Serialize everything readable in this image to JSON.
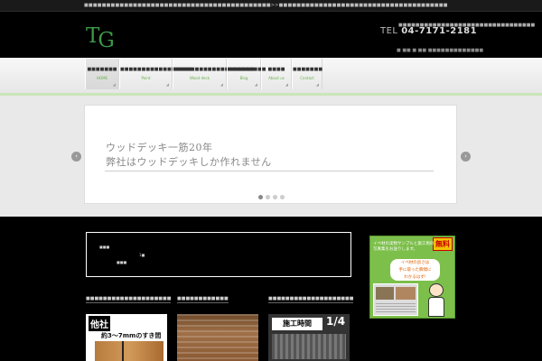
{
  "topbar": {
    "description": "■■■■■■■■■■■■■■■■■■■■■■■■■■■■■■■■■■■■■■■■■■>>■■■■■■■■■■■■■■■■■■■■■■■■■■■■■■■■■■■■■■"
  },
  "header": {
    "logo_t": "T",
    "logo_g": "G",
    "contact_top": "■■■■■■■■■■■■■■■■■■■■■■■■■■■■■■■■",
    "tel_label": "TEL",
    "tel_number": "04-7171-2181",
    "contact_bottom": "■ ■■  ■ ■■ ■■■■■■■■■■■■■"
  },
  "nav": {
    "items": [
      {
        "jp": "■■■■■■■",
        "en": "HOME"
      },
      {
        "jp": "■■■■■■■■■■■■■■■■■",
        "en": "Point"
      },
      {
        "jp": "■■■■■■■■■■■■■■■■■■■",
        "en": "Wood deck"
      },
      {
        "jp": "■■■■■■■■■",
        "en": "Blog"
      },
      {
        "jp": "■■■■",
        "en": "About us"
      },
      {
        "jp": "■■■■■■■",
        "en": "Contact"
      }
    ]
  },
  "slider": {
    "line1": "ウッドデッキ一筋20年",
    "line2": "弊社はウッドデッキしか作れません",
    "prev": "‹",
    "next": "›"
  },
  "infobox": {
    "t1": "■■■",
    "t2": "1■",
    "t3": "■■■"
  },
  "banner": {
    "free": "無料",
    "heading": "イペ材の実物サンプルと施工例の写真集をお送りします。",
    "bubble_l1": "イペ材の良さは",
    "bubble_l2": "手に取った瞬間に",
    "bubble_l3": "わかるはず!"
  },
  "columns": [
    {
      "title": "■■■■■■■■■■■■■■■■■■■■",
      "label": "他社",
      "sub": "約3〜7mmのすき間"
    },
    {
      "title": "■■■■■■■■■■■■"
    },
    {
      "title": "■■■■■■■■■■■■■■■■■■■■",
      "label": "施工時間",
      "sub": "1/4"
    }
  ]
}
